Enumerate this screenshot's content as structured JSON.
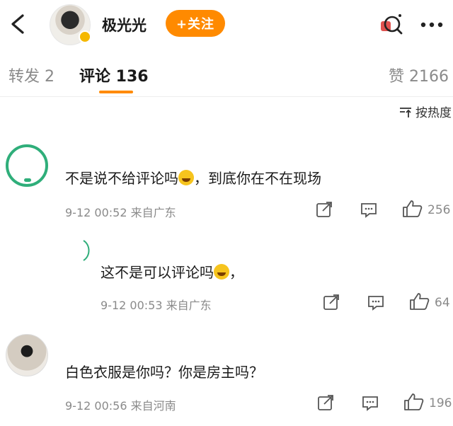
{
  "header": {
    "username": "极光光",
    "follow_label": "+关注"
  },
  "tabs": {
    "repost": "转发 2",
    "comment": "评论 136",
    "like": "赞 2166"
  },
  "sort_label": "按热度",
  "comments": [
    {
      "text_before": "不是说不给评论吗",
      "emoji": "laughing-emoji",
      "text_after": "，到底你在不在现场",
      "time": "9-12 00:52",
      "location": "来自广东",
      "likes": "256"
    },
    {
      "text_before": "这不是可以评论吗",
      "emoji": "laughing-emoji",
      "text_after": "，",
      "time": "9-12 00:53",
      "location": "来自广东",
      "likes": "64"
    },
    {
      "text_before": "白色衣服是你吗？你是房主吗？",
      "text_after": "",
      "time": "9-12 00:56",
      "location": "来自河南",
      "likes": "196"
    }
  ],
  "colors": {
    "accent": "#ff8a00",
    "avatar_ring": "#2fae7a",
    "meta_gray": "#8a8a8a"
  }
}
